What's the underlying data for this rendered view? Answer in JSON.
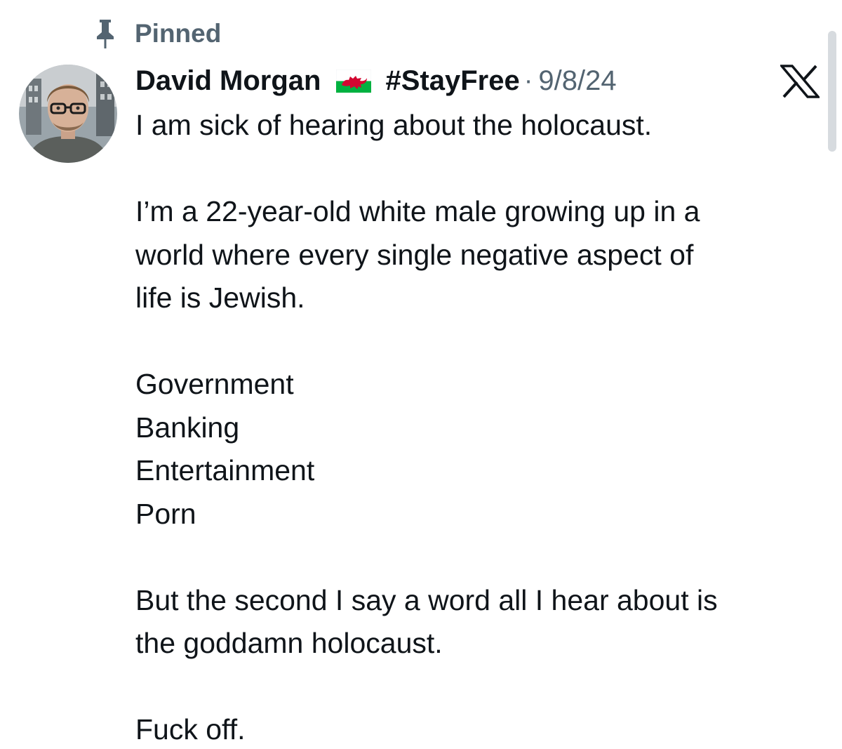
{
  "pinned": {
    "label": "Pinned",
    "icon": "pin-icon"
  },
  "author": {
    "display_name": "David Morgan",
    "flag_icon": "wales-flag-icon",
    "hashtag": "#StayFree",
    "separator": "·",
    "date": "9/8/24",
    "avatar_icon": "avatar-photo"
  },
  "platform_logo": "x-logo-icon",
  "tweet": {
    "line1": "I am sick of hearing about the holocaust.",
    "paragraph2": {
      "line1": "I’m a 22-year-old white male growing up in a",
      "line2": "world where every single negative aspect of",
      "line3": "life is Jewish."
    },
    "list": [
      "Government",
      "Banking",
      "Entertainment",
      "Porn"
    ],
    "paragraph4": {
      "line1": "But the second I say a word all I hear about is",
      "line2": "the goddamn holocaust."
    },
    "closing": "Fuck off."
  },
  "colors": {
    "text_primary": "#0f1419",
    "text_secondary": "#536471",
    "flag_green": "#00b140",
    "flag_red": "#d30731"
  }
}
